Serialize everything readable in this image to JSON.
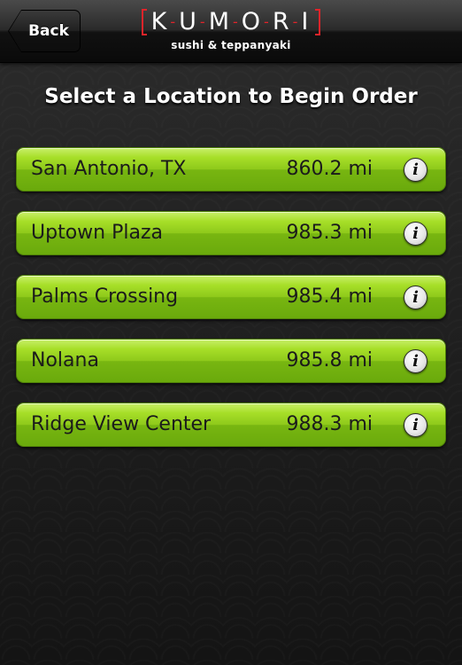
{
  "navbar": {
    "back_label": "Back",
    "logo": {
      "brand": "KUMORI",
      "tagline": "sushi & teppanyaki",
      "accent_color": "#e0242a"
    }
  },
  "page_title": "Select a Location to Begin Order",
  "locations": [
    {
      "name": "San Antonio, TX",
      "distance": "860.2 mi",
      "info_icon": "info-icon"
    },
    {
      "name": "Uptown Plaza",
      "distance": "985.3 mi",
      "info_icon": "info-icon"
    },
    {
      "name": "Palms Crossing",
      "distance": "985.4 mi",
      "info_icon": "info-icon"
    },
    {
      "name": "Nolana",
      "distance": "985.8 mi",
      "info_icon": "info-icon"
    },
    {
      "name": "Ridge View Center",
      "distance": "988.3 mi",
      "info_icon": "info-icon"
    }
  ],
  "colors": {
    "row_green": "#8ec91b",
    "background": "#1f1f1f",
    "brand_red": "#e0242a"
  }
}
